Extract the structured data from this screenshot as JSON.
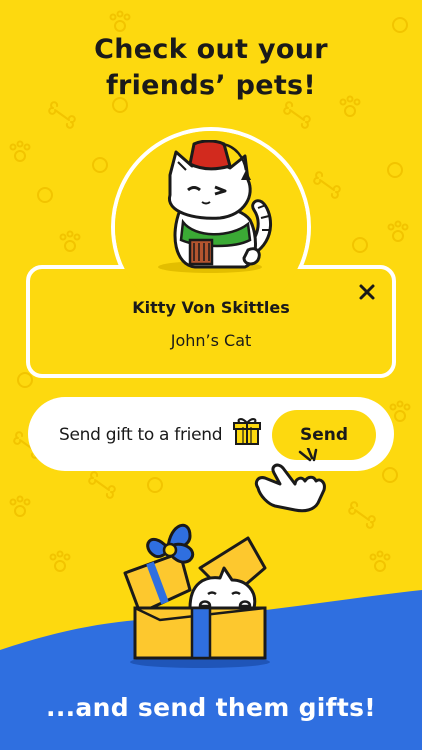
{
  "header": {
    "line1": "Check out your",
    "line2": "friends’ pets!"
  },
  "pet_card": {
    "name": "Kitty Von Skittles",
    "owner": "John’s Cat",
    "close_icon": "close-icon"
  },
  "gift_bar": {
    "label": "Send gift to a friend",
    "gift_icon": "gift-icon",
    "send_label": "Send"
  },
  "footer": {
    "text": "...and send them gifts!"
  },
  "colors": {
    "background": "#FDD90F",
    "card_border": "#FFFFFF",
    "wave": "#2F6FE0",
    "text": "#1A1A1A"
  }
}
